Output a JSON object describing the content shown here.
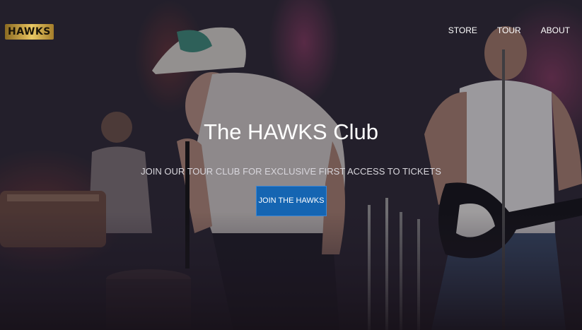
{
  "brand": {
    "logo_text": "HAWKS"
  },
  "nav": {
    "items": [
      {
        "label": "STORE"
      },
      {
        "label": "TOUR"
      },
      {
        "label": "ABOUT"
      }
    ]
  },
  "hero": {
    "title": "The HAWKS Club",
    "subtitle": "JOIN OUR TOUR CLUB FOR EXCLUSIVE FIRST ACCESS TO TICKETS",
    "cta_label": "JOIN THE HAWKS",
    "cta_color": "#1565b2"
  }
}
